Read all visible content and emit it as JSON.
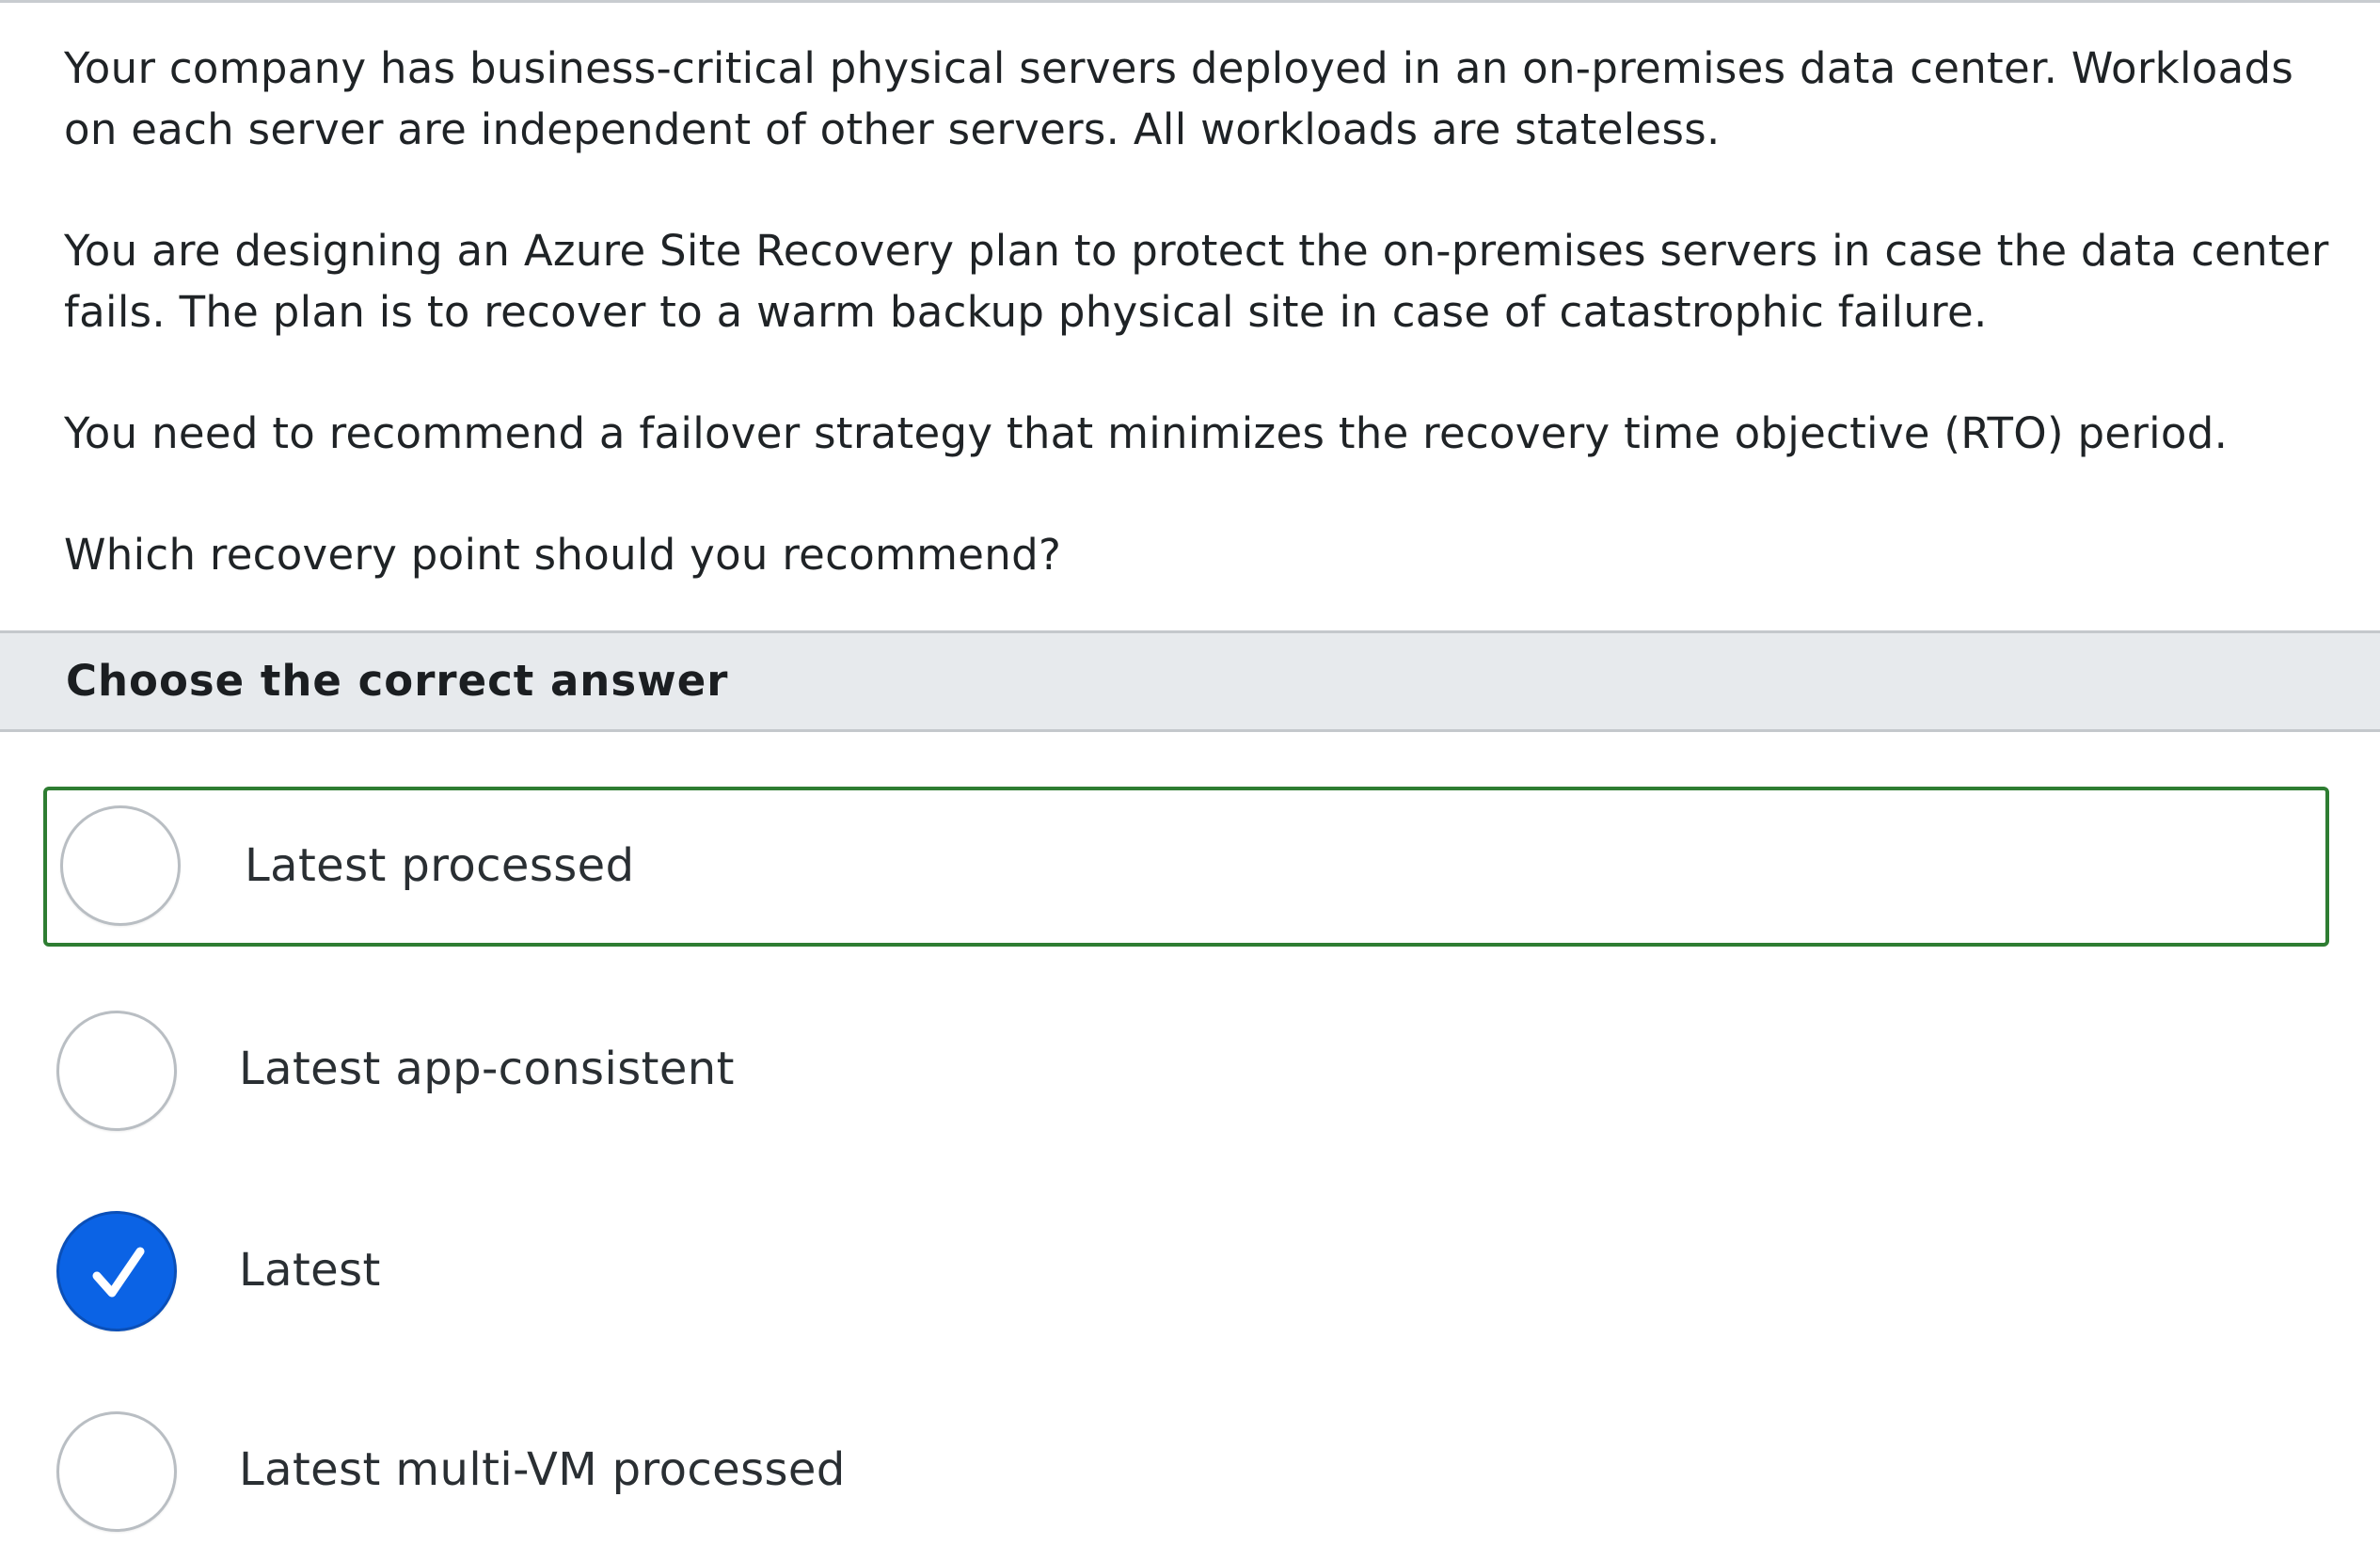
{
  "question": {
    "paragraphs": [
      "Your company has business-critical physical servers deployed in an on-premises data center. Workloads on each server are independent of other servers. All workloads are stateless.",
      "You are designing an Azure Site Recovery plan to protect the on-premises servers in case the data center fails. The plan is to recover to a warm backup physical site in case of catastrophic failure.",
      "You need to recommend a failover strategy that minimizes the recovery time objective (RTO) period.",
      "Which recovery point should you recommend?"
    ]
  },
  "answers": {
    "header": "Choose the correct answer",
    "selected_index": 2,
    "options": [
      {
        "label": "Latest processed",
        "highlighted": true,
        "checked": false
      },
      {
        "label": "Latest app-consistent",
        "highlighted": false,
        "checked": false
      },
      {
        "label": "Latest",
        "highlighted": false,
        "checked": true
      },
      {
        "label": "Latest multi-VM processed",
        "highlighted": false,
        "checked": false
      }
    ]
  },
  "colors": {
    "highlight_border": "#2e7d32",
    "checked_fill": "#0b63e5",
    "header_bg": "#e7eaed"
  },
  "icons": {
    "checked": "checkmark-icon"
  }
}
